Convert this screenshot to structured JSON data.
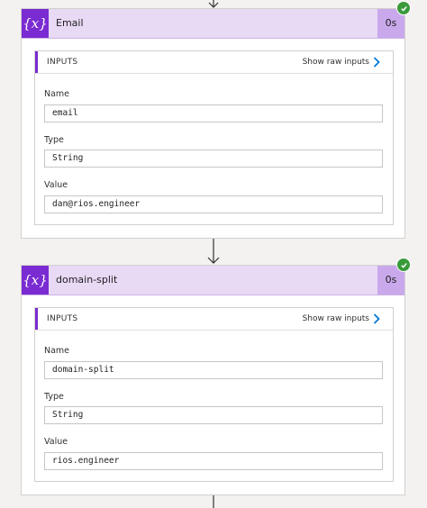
{
  "colors": {
    "accent": "#7a2bd1",
    "header_bg": "#e8d9f5",
    "duration_bg": "#c9a9ec",
    "success": "#3a9a3a"
  },
  "icons": {
    "variable": "curly-braces-x",
    "success": "check-circle",
    "chevron": "chevron-right",
    "flow_arrow": "arrow-down"
  },
  "actions": [
    {
      "icon_text": "{x}",
      "title": "Email",
      "duration": "0s",
      "inputs_label": "INPUTS",
      "show_raw_label": "Show raw inputs",
      "fields": [
        {
          "label": "Name",
          "value": "email"
        },
        {
          "label": "Type",
          "value": "String"
        },
        {
          "label": "Value",
          "value": "dan@rios.engineer"
        }
      ]
    },
    {
      "icon_text": "{x}",
      "title": "domain-split",
      "duration": "0s",
      "inputs_label": "INPUTS",
      "show_raw_label": "Show raw inputs",
      "fields": [
        {
          "label": "Name",
          "value": "domain-split"
        },
        {
          "label": "Type",
          "value": "String"
        },
        {
          "label": "Value",
          "value": "rios.engineer"
        }
      ]
    }
  ]
}
